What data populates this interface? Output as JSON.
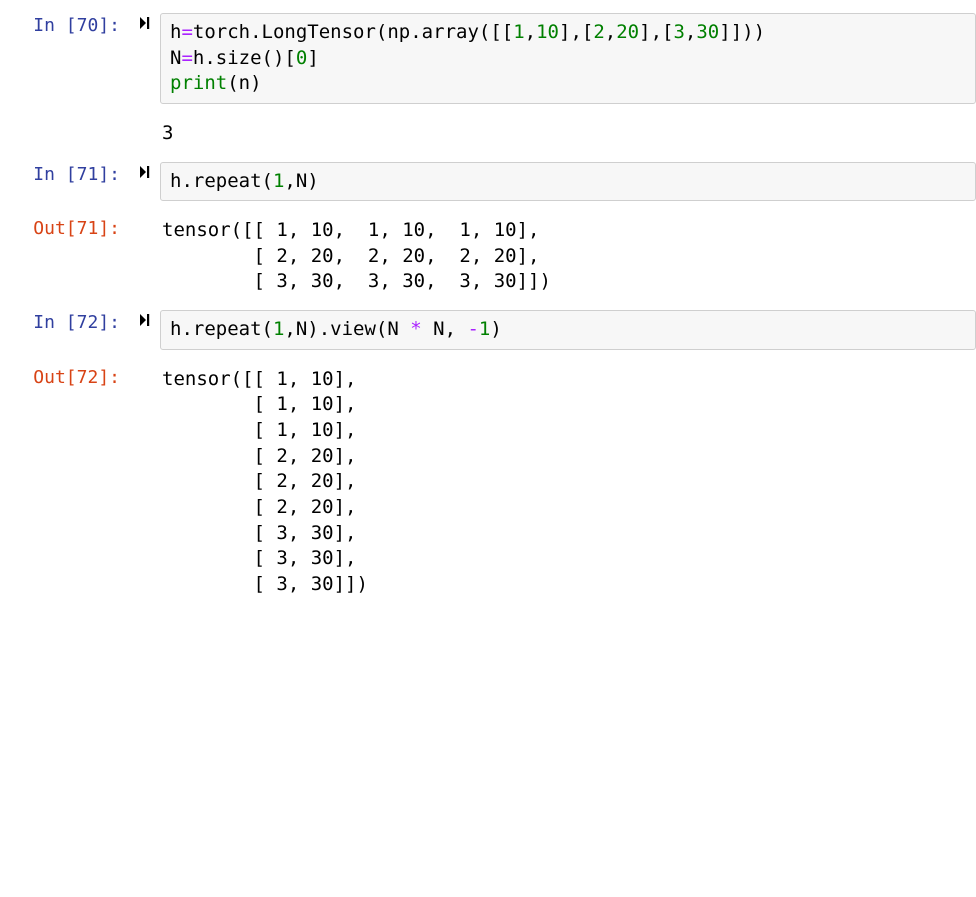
{
  "cells": [
    {
      "kind": "in",
      "prompt_label": "In [70]:",
      "code_tokens": [
        {
          "t": "h",
          "c": "tok-var"
        },
        {
          "t": "=",
          "c": "tok-op"
        },
        {
          "t": "torch.LongTensor(np.array([[",
          "c": "tok-var"
        },
        {
          "t": "1",
          "c": "tok-num"
        },
        {
          "t": ",",
          "c": "tok-var"
        },
        {
          "t": "10",
          "c": "tok-num"
        },
        {
          "t": "],[",
          "c": "tok-var"
        },
        {
          "t": "2",
          "c": "tok-num"
        },
        {
          "t": ",",
          "c": "tok-var"
        },
        {
          "t": "20",
          "c": "tok-num"
        },
        {
          "t": "],[",
          "c": "tok-var"
        },
        {
          "t": "3",
          "c": "tok-num"
        },
        {
          "t": ",",
          "c": "tok-var"
        },
        {
          "t": "30",
          "c": "tok-num"
        },
        {
          "t": "]]))",
          "c": "tok-var"
        },
        {
          "t": "\n",
          "c": ""
        },
        {
          "t": "N",
          "c": "tok-var"
        },
        {
          "t": "=",
          "c": "tok-op"
        },
        {
          "t": "h.size()[",
          "c": "tok-var"
        },
        {
          "t": "0",
          "c": "tok-num"
        },
        {
          "t": "]",
          "c": "tok-var"
        },
        {
          "t": "\n",
          "c": ""
        },
        {
          "t": "print",
          "c": "tok-func"
        },
        {
          "t": "(n)",
          "c": "tok-var"
        }
      ]
    },
    {
      "kind": "stdout",
      "prompt_label": "",
      "text": "3"
    },
    {
      "kind": "in",
      "prompt_label": "In [71]:",
      "code_tokens": [
        {
          "t": "h.repeat(",
          "c": "tok-var"
        },
        {
          "t": "1",
          "c": "tok-num"
        },
        {
          "t": ",N)",
          "c": "tok-var"
        }
      ]
    },
    {
      "kind": "out",
      "prompt_label": "Out[71]:",
      "text": "tensor([[ 1, 10,  1, 10,  1, 10],\n        [ 2, 20,  2, 20,  2, 20],\n        [ 3, 30,  3, 30,  3, 30]])"
    },
    {
      "kind": "in",
      "prompt_label": "In [72]:",
      "code_tokens": [
        {
          "t": "h.repeat(",
          "c": "tok-var"
        },
        {
          "t": "1",
          "c": "tok-num"
        },
        {
          "t": ",N).view(N ",
          "c": "tok-var"
        },
        {
          "t": "*",
          "c": "tok-op"
        },
        {
          "t": " N, ",
          "c": "tok-var"
        },
        {
          "t": "-",
          "c": "tok-op"
        },
        {
          "t": "1",
          "c": "tok-num"
        },
        {
          "t": ")",
          "c": "tok-var"
        }
      ]
    },
    {
      "kind": "out",
      "prompt_label": "Out[72]:",
      "text": "tensor([[ 1, 10],\n        [ 1, 10],\n        [ 1, 10],\n        [ 2, 20],\n        [ 2, 20],\n        [ 2, 20],\n        [ 3, 30],\n        [ 3, 30],\n        [ 3, 30]])"
    }
  ]
}
